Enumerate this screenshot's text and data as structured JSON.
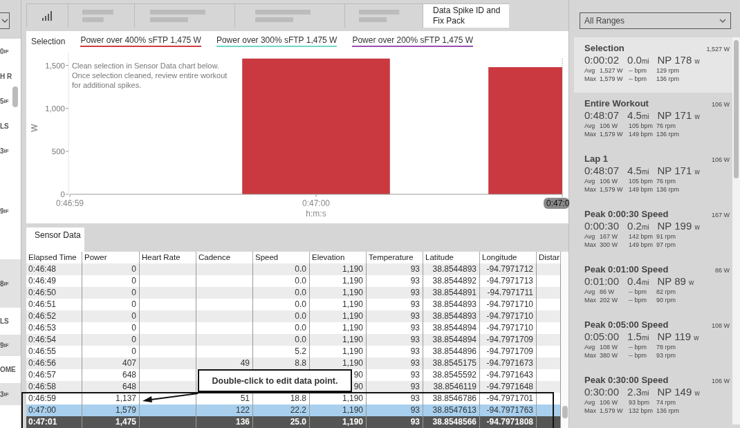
{
  "left_strip": {
    "items": [
      {
        "value": "0",
        "unit": "IF"
      },
      {
        "value": "H R"
      },
      {
        "value": "5",
        "unit": "IF"
      },
      {
        "value": "LS"
      },
      {
        "value": "3",
        "unit": "IF"
      },
      {
        "value": "9",
        "unit": "IF"
      },
      {
        "value": "8",
        "unit": "IF"
      },
      {
        "value": "LS"
      },
      {
        "value": "9",
        "unit": "IF"
      },
      {
        "value": "OME"
      },
      {
        "value": "3",
        "unit": "IF"
      }
    ]
  },
  "top_tabs": [
    {
      "kind": "icon",
      "selected": false
    },
    {
      "kind": "blurred",
      "selected": false
    },
    {
      "kind": "blurred",
      "selected": false
    },
    {
      "kind": "blurred",
      "selected": false
    },
    {
      "kind": "blurred",
      "selected": false
    },
    {
      "kind": "text",
      "label": "Data Spike ID and Fix Pack",
      "selected": true
    }
  ],
  "chart_panel": {
    "legend_title": "Selection",
    "legend": [
      {
        "label": "Power over 400% sFTP  1,475 W",
        "color": "#d03a3f"
      },
      {
        "label": "Power over 300% sFTP  1,475 W",
        "color": "#6fd6c8"
      },
      {
        "label": "Power over 200% sFTP  1,475 W",
        "color": "#9b4fb0"
      }
    ],
    "note": "Clean selection in Sensor Data chart below. Once selection cleaned, review entire workout for additional spikes.",
    "chart_data": {
      "type": "bar",
      "xlabel": "h:m:s",
      "ylabel": "W",
      "categories": [
        "0:46:59",
        "0:47:00",
        "0:47:0"
      ],
      "series": [
        {
          "color": "#c9393f",
          "values": [
            null,
            1580,
            1480
          ]
        }
      ],
      "ylim": [
        0,
        1650
      ],
      "yticks": [
        {
          "value": 0,
          "label": "0"
        },
        {
          "value": 500,
          "label": "500"
        },
        {
          "value": 1000,
          "label": "1,000"
        },
        {
          "value": 1500,
          "label": "1,500"
        }
      ]
    }
  },
  "sensor_tab": {
    "label": "Sensor Data",
    "selected": true
  },
  "table": {
    "columns": [
      "Elapsed Time",
      "Power",
      "Heart Rate",
      "Cadence",
      "Speed",
      "Elevation",
      "Temperature",
      "Latitude",
      "Longitude",
      "Distar"
    ],
    "rows": [
      {
        "selected": false,
        "focused": false,
        "cells": [
          "0:46:48",
          "0",
          null,
          null,
          "0.0",
          "1,190",
          "93",
          "38.8544893",
          "-94.7971712",
          null
        ]
      },
      {
        "selected": false,
        "focused": false,
        "cells": [
          "0:46:49",
          "0",
          null,
          null,
          "0.0",
          "1,190",
          "93",
          "38.8544892",
          "-94.7971713",
          null
        ]
      },
      {
        "selected": false,
        "focused": false,
        "cells": [
          "0:46:50",
          "0",
          null,
          null,
          "0.0",
          "1,190",
          "93",
          "38.8544891",
          "-94.7971711",
          null
        ]
      },
      {
        "selected": false,
        "focused": false,
        "cells": [
          "0:46:51",
          "0",
          null,
          null,
          "0.0",
          "1,190",
          "93",
          "38.8544893",
          "-94.7971710",
          null
        ]
      },
      {
        "selected": false,
        "focused": false,
        "cells": [
          "0:46:52",
          "0",
          null,
          null,
          "0.0",
          "1,190",
          "93",
          "38.8544893",
          "-94.7971710",
          null
        ]
      },
      {
        "selected": false,
        "focused": false,
        "cells": [
          "0:46:53",
          "0",
          null,
          null,
          "0.0",
          "1,190",
          "93",
          "38.8544894",
          "-94.7971710",
          null
        ]
      },
      {
        "selected": false,
        "focused": false,
        "cells": [
          "0:46:54",
          "0",
          null,
          null,
          "0.0",
          "1,190",
          "93",
          "38.8544894",
          "-94.7971709",
          null
        ]
      },
      {
        "selected": false,
        "focused": false,
        "cells": [
          "0:46:55",
          "0",
          null,
          null,
          "5.2",
          "1,190",
          "93",
          "38.8544896",
          "-94.7971709",
          null
        ]
      },
      {
        "selected": false,
        "focused": false,
        "cells": [
          "0:46:56",
          "407",
          null,
          "49",
          "8.8",
          "1,190",
          "93",
          "38.8545175",
          "-94.7971673",
          null
        ]
      },
      {
        "selected": false,
        "focused": false,
        "cells": [
          "0:46:57",
          "648",
          null,
          null,
          null,
          "90",
          "93",
          "38.8545592",
          "-94.7971643",
          null
        ]
      },
      {
        "selected": false,
        "focused": false,
        "cells": [
          "0:46:58",
          "648",
          null,
          null,
          null,
          "90",
          "93",
          "38.8546119",
          "-94.7971648",
          null
        ]
      },
      {
        "selected": false,
        "focused": false,
        "cells": [
          "0:46:59",
          "1,137",
          null,
          "51",
          "18.8",
          "1,190",
          "93",
          "38.8546786",
          "-94.7971701",
          null
        ]
      },
      {
        "selected": true,
        "focused": false,
        "cells": [
          "0:47:00",
          "1,579",
          null,
          "122",
          "22.2",
          "1,190",
          "93",
          "38.8547613",
          "-94.7971763",
          null
        ]
      },
      {
        "selected": true,
        "focused": true,
        "cells": [
          "0:47:01",
          "1,475",
          null,
          "136",
          "25.0",
          "1,190",
          "93",
          "38.8548566",
          "-94.7971808",
          null
        ]
      }
    ]
  },
  "callout": {
    "text": "Double-click to edit data point."
  },
  "ranges": {
    "dropdown": "All Ranges",
    "items": [
      {
        "selected": true,
        "title": "Selection",
        "side": "1,527 W",
        "time": "0:00:02",
        "dist": "0.0",
        "dist_unit": "mi",
        "np": "NP 178",
        "np_unit": "w",
        "avg": [
          "Avg",
          "1,527 W",
          "-- bpm",
          "129 rpm"
        ],
        "max": [
          "Max",
          "1,579 W",
          "-- bpm",
          "136 rpm"
        ]
      },
      {
        "selected": false,
        "title": "Entire Workout",
        "side": "106 W",
        "time": "0:48:07",
        "dist": "4.5",
        "dist_unit": "mi",
        "np": "NP 171",
        "np_unit": "w",
        "avg": [
          "Avg",
          "106 W",
          "105 bpm",
          "76 rpm"
        ],
        "max": [
          "Max",
          "1,579 W",
          "149 bpm",
          "136 rpm"
        ]
      },
      {
        "selected": false,
        "title": "Lap 1",
        "side": "106 W",
        "time": "0:48:07",
        "dist": "4.5",
        "dist_unit": "mi",
        "np": "NP 171",
        "np_unit": "w",
        "avg": [
          "Avg",
          "106 W",
          "105 bpm",
          "76 rpm"
        ],
        "max": [
          "Max",
          "1,579 W",
          "149 bpm",
          "136 rpm"
        ]
      },
      {
        "selected": false,
        "title": "Peak 0:00:30 Speed",
        "side": "167 W",
        "time": "0:00:30",
        "dist": "0.2",
        "dist_unit": "mi",
        "np": "NP 199",
        "np_unit": "w",
        "avg": [
          "Avg",
          "167 W",
          "142 bpm",
          "91 rpm"
        ],
        "max": [
          "Max",
          "300 W",
          "149 bpm",
          "97 rpm"
        ]
      },
      {
        "selected": false,
        "title": "Peak 0:01:00 Speed",
        "side": "86 W",
        "time": "0:01:00",
        "dist": "0.4",
        "dist_unit": "mi",
        "np": "NP 89",
        "np_unit": "w",
        "avg": [
          "Avg",
          "86 W",
          "-- bpm",
          "82 rpm"
        ],
        "max": [
          "Max",
          "202 W",
          "-- bpm",
          "90 rpm"
        ]
      },
      {
        "selected": false,
        "title": "Peak 0:05:00 Speed",
        "side": "108 W",
        "time": "0:05:00",
        "dist": "1.5",
        "dist_unit": "mi",
        "np": "NP 119",
        "np_unit": "w",
        "avg": [
          "Avg",
          "108 W",
          "-- bpm",
          "78 rpm"
        ],
        "max": [
          "Max",
          "380 W",
          "-- bpm",
          "93 rpm"
        ]
      },
      {
        "selected": false,
        "title": "Peak 0:30:00 Speed",
        "side": "106 W",
        "time": "0:30:00",
        "dist": "2.3",
        "dist_unit": "mi",
        "np": "NP 149",
        "np_unit": "w",
        "avg": [
          "Avg",
          "106 W",
          "93 bpm",
          "74 rpm"
        ],
        "max": [
          "Max",
          "1,579 W",
          "132 bpm",
          "136 rpm"
        ]
      }
    ]
  }
}
